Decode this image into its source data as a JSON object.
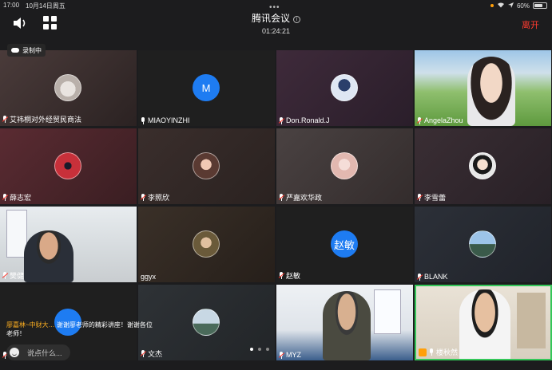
{
  "status": {
    "time": "17:00",
    "date": "10月14日周五",
    "battery": "60%",
    "battery_level": 0.6
  },
  "meeting": {
    "title": "腾讯会议",
    "duration": "01:24:21",
    "leave_label": "离开",
    "recording_label": "录制中"
  },
  "tiles": [
    {
      "name": "艾祎桐对外经贸民商法",
      "muted": true
    },
    {
      "name": "MIAOYINZHI",
      "muted": false,
      "avatar_letter": "M"
    },
    {
      "name": "Don.Ronald.J",
      "muted": true
    },
    {
      "name": "AngelaZhou",
      "muted": true
    },
    {
      "name": "薛志宏",
      "muted": true
    },
    {
      "name": "李照欣",
      "muted": true
    },
    {
      "name": "严嘉欢华政",
      "muted": true
    },
    {
      "name": "李雪蕾",
      "muted": true
    },
    {
      "name": "樊健",
      "muted": true
    },
    {
      "name": "ggyx",
      "muted": false
    },
    {
      "name": "赵敏",
      "muted": true,
      "avatar_letter": "赵敏"
    },
    {
      "name": "BLANK",
      "muted": true
    },
    {
      "name": "",
      "muted": true
    },
    {
      "name": "文杰",
      "muted": true
    },
    {
      "name": "MYZ",
      "muted": true
    },
    {
      "name": "楼秋然",
      "muted": false
    }
  ],
  "chat": {
    "sender": "廖嘉林~中财大…",
    "message": "谢谢廖老师的精彩讲座！谢谢各位老师！"
  },
  "input": {
    "placeholder": "说点什么..."
  },
  "colors": {
    "accent": "#1e7cf2",
    "leave": "#ff3b30",
    "active_speaker": "#34c759"
  }
}
